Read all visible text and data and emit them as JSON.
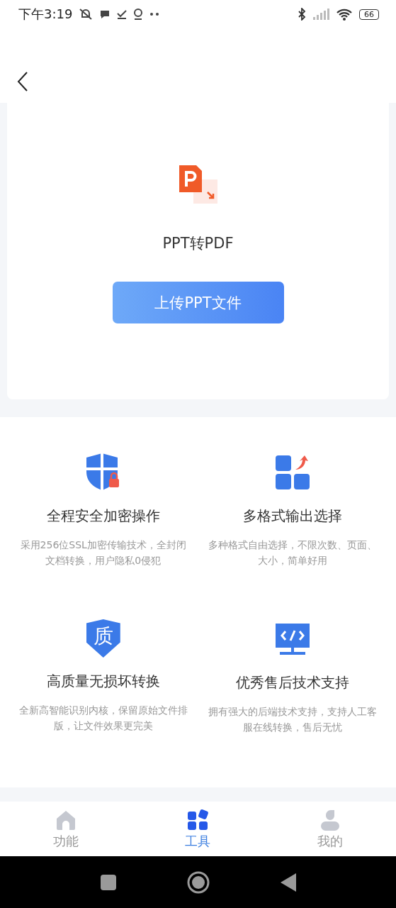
{
  "status_bar": {
    "time": "下午3:19",
    "battery": "66"
  },
  "tool": {
    "title": "PPT转PDF",
    "upload_button": "上传PPT文件"
  },
  "features": [
    {
      "kind": "security",
      "title": "全程安全加密操作",
      "description": "采用256位SSL加密传输技术，全封闭文档转换，用户隐私0侵犯"
    },
    {
      "kind": "formats",
      "title": "多格式输出选择",
      "description": "多种格式自由选择，不限次数、页面、大小，简单好用"
    },
    {
      "kind": "quality",
      "badge": "质",
      "title": "高质量无损坏转换",
      "description": "全新高智能识别内核，保留原始文件排版，让文件效果更完美"
    },
    {
      "kind": "support",
      "title": "优秀售后技术支持",
      "description": "拥有强大的后端技术支持，支持人工客服在线转换，售后无忧"
    }
  ],
  "tabs": [
    {
      "kind": "home",
      "label": "功能",
      "selected": false
    },
    {
      "kind": "tools",
      "label": "工具",
      "selected": true
    },
    {
      "kind": "profile",
      "label": "我的",
      "selected": false
    }
  ]
}
